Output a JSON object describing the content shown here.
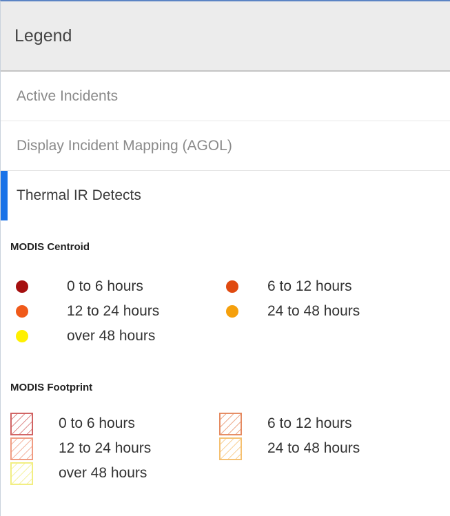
{
  "legend": {
    "title": "Legend"
  },
  "tabs": [
    {
      "label": "Active Incidents"
    },
    {
      "label": "Display Incident Mapping (AGOL)"
    },
    {
      "label": "Thermal IR Detects"
    }
  ],
  "centroid": {
    "title": "MODIS Centroid",
    "items": [
      {
        "label": "0 to 6 hours",
        "color": "#a50f0f"
      },
      {
        "label": "6 to 12 hours",
        "color": "#e04a10"
      },
      {
        "label": "12 to 24 hours",
        "color": "#f05a1a"
      },
      {
        "label": "24 to 48 hours",
        "color": "#f5a00c"
      },
      {
        "label": "over 48 hours",
        "color": "#fff000"
      }
    ]
  },
  "footprint": {
    "title": "MODIS Footprint",
    "items": [
      {
        "label": "0 to 6 hours",
        "color": "#d06060"
      },
      {
        "label": "6 to 12 hours",
        "color": "#e58a60"
      },
      {
        "label": "12 to 24 hours",
        "color": "#f09a80"
      },
      {
        "label": "24 to 48 hours",
        "color": "#f5c070"
      },
      {
        "label": "over 48 hours",
        "color": "#f2ee80"
      }
    ]
  }
}
